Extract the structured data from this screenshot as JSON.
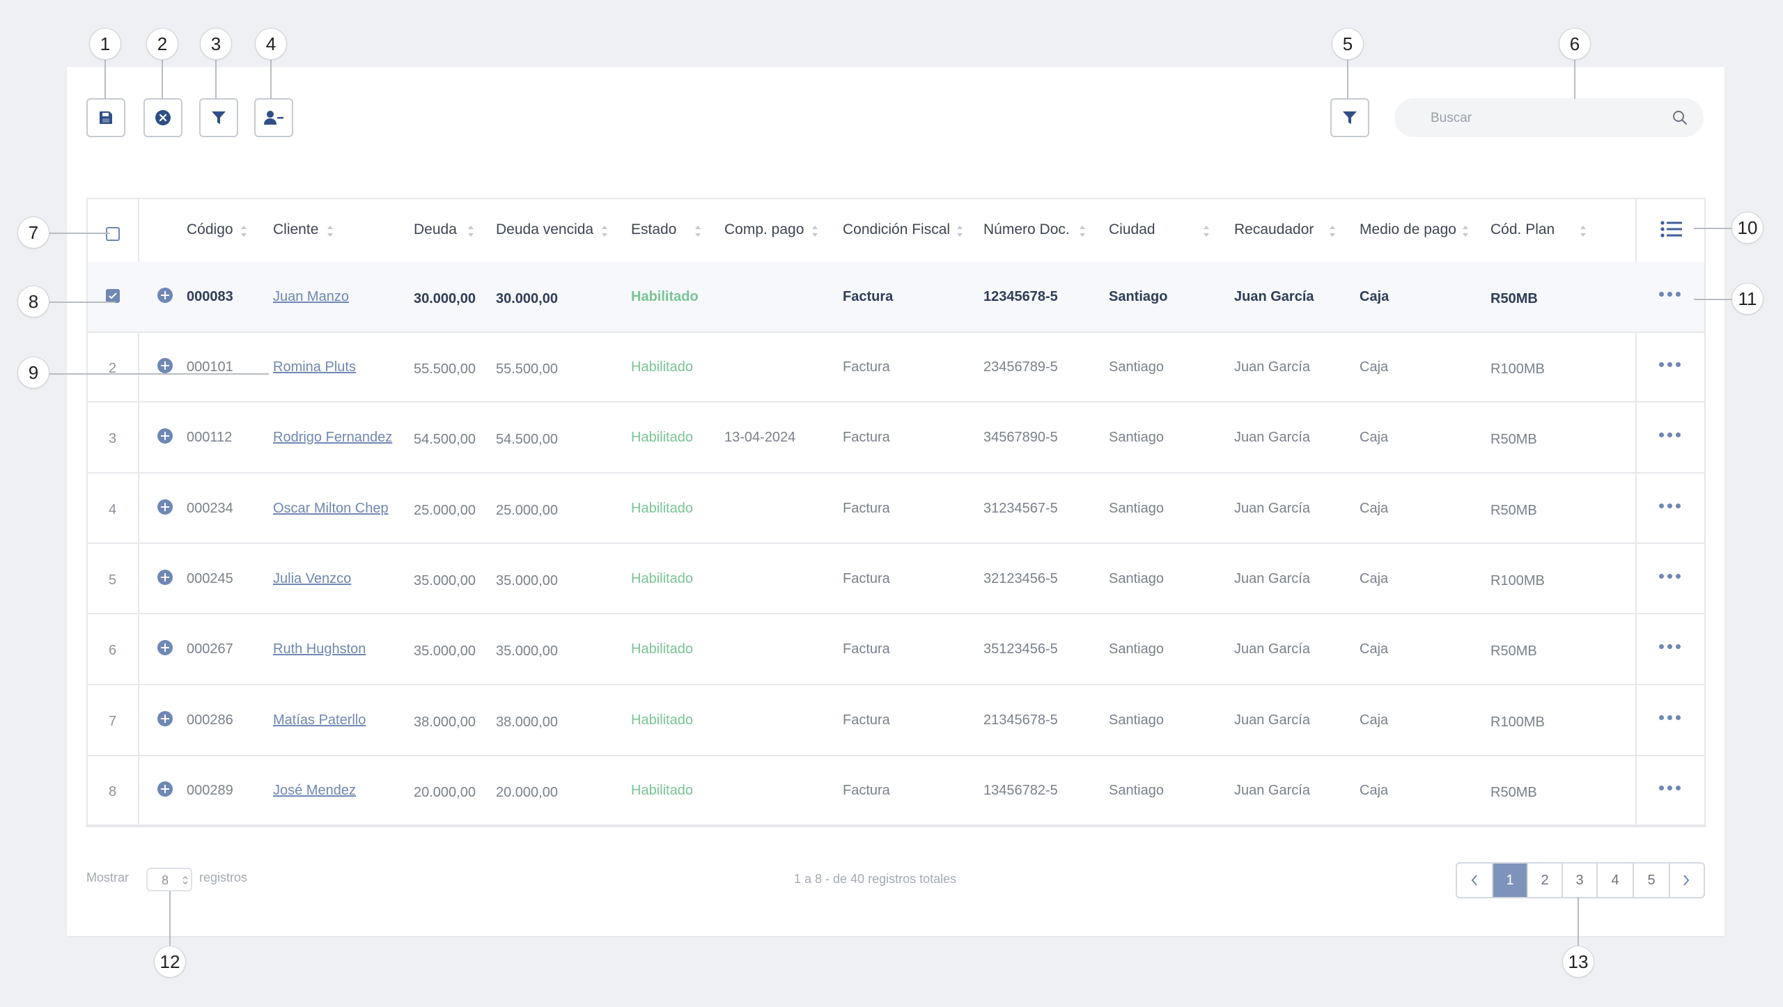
{
  "toolbar": {
    "buttons": [
      {
        "icon": "save-icon"
      },
      {
        "icon": "cancel-icon"
      },
      {
        "icon": "filter-icon"
      },
      {
        "icon": "remove-user-icon"
      }
    ],
    "filter_right_icon": "filter-icon"
  },
  "search": {
    "placeholder": "Buscar",
    "icon": "search-icon"
  },
  "table": {
    "columns": [
      "Código",
      "Cliente",
      "Deuda",
      "Deuda vencida",
      "Estado",
      "Comp. pago",
      "Condición Fiscal",
      "Número Doc.",
      "Ciudad",
      "Recaudador",
      "Medio de pago",
      "Cód. Plan"
    ],
    "column_settings_icon": "list-icon",
    "rows": [
      {
        "index": "",
        "selected": true,
        "code": "000083",
        "client": "Juan Manzo",
        "debt": "30.000,00",
        "overdue": "30.000,00",
        "status": "Habilitado",
        "comp": "",
        "fiscal": "Factura",
        "doc": "12345678-5",
        "city": "Santiago",
        "collector": "Juan García",
        "payment": "Caja",
        "plan": "R50MB"
      },
      {
        "index": "2",
        "selected": false,
        "code": "000101",
        "client": "Romina Pluts",
        "debt": "55.500,00",
        "overdue": "55.500,00",
        "status": "Habilitado",
        "comp": "",
        "fiscal": "Factura",
        "doc": "23456789-5",
        "city": "Santiago",
        "collector": "Juan García",
        "payment": "Caja",
        "plan": "R100MB"
      },
      {
        "index": "3",
        "selected": false,
        "code": "000112",
        "client": "Rodrigo Fernandez",
        "debt": "54.500,00",
        "overdue": "54.500,00",
        "status": "Habilitado",
        "comp": "13-04-2024",
        "fiscal": "Factura",
        "doc": "34567890-5",
        "city": "Santiago",
        "collector": "Juan García",
        "payment": "Caja",
        "plan": "R50MB"
      },
      {
        "index": "4",
        "selected": false,
        "code": "000234",
        "client": "Oscar Milton Chep",
        "debt": "25.000,00",
        "overdue": "25.000,00",
        "status": "Habilitado",
        "comp": "",
        "fiscal": "Factura",
        "doc": "31234567-5",
        "city": "Santiago",
        "collector": "Juan García",
        "payment": "Caja",
        "plan": "R50MB"
      },
      {
        "index": "5",
        "selected": false,
        "code": "000245",
        "client": "Julia Venzco",
        "debt": "35.000,00",
        "overdue": "35.000,00",
        "status": "Habilitado",
        "comp": "",
        "fiscal": "Factura",
        "doc": "32123456-5",
        "city": "Santiago",
        "collector": "Juan García",
        "payment": "Caja",
        "plan": "R100MB"
      },
      {
        "index": "6",
        "selected": false,
        "code": "000267",
        "client": "Ruth Hughston",
        "debt": "35.000,00",
        "overdue": "35.000,00",
        "status": "Habilitado",
        "comp": "",
        "fiscal": "Factura",
        "doc": "35123456-5",
        "city": "Santiago",
        "collector": "Juan García",
        "payment": "Caja",
        "plan": "R50MB"
      },
      {
        "index": "7",
        "selected": false,
        "code": "000286",
        "client": "Matías Paterllo",
        "debt": "38.000,00",
        "overdue": "38.000,00",
        "status": "Habilitado",
        "comp": "",
        "fiscal": "Factura",
        "doc": "21345678-5",
        "city": "Santiago",
        "collector": "Juan García",
        "payment": "Caja",
        "plan": "R100MB"
      },
      {
        "index": "8",
        "selected": false,
        "code": "000289",
        "client": "José Mendez",
        "debt": "20.000,00",
        "overdue": "20.000,00",
        "status": "Habilitado",
        "comp": "",
        "fiscal": "Factura",
        "doc": "13456782-5",
        "city": "Santiago",
        "collector": "Juan García",
        "payment": "Caja",
        "plan": "R50MB"
      }
    ]
  },
  "footer": {
    "show_label": "Mostrar",
    "page_size": "8",
    "records_label": "registros",
    "summary": "1 a 8 - de 40 registros totales"
  },
  "pagination": {
    "pages": [
      "1",
      "2",
      "3",
      "4",
      "5"
    ],
    "active": "1"
  },
  "callouts": [
    "1",
    "2",
    "3",
    "4",
    "5",
    "6",
    "7",
    "8",
    "9",
    "10",
    "11",
    "12",
    "13"
  ],
  "colors": {
    "accent": "#6f87b3",
    "status_green": "#78c493",
    "active_page": "#7d93bb"
  }
}
